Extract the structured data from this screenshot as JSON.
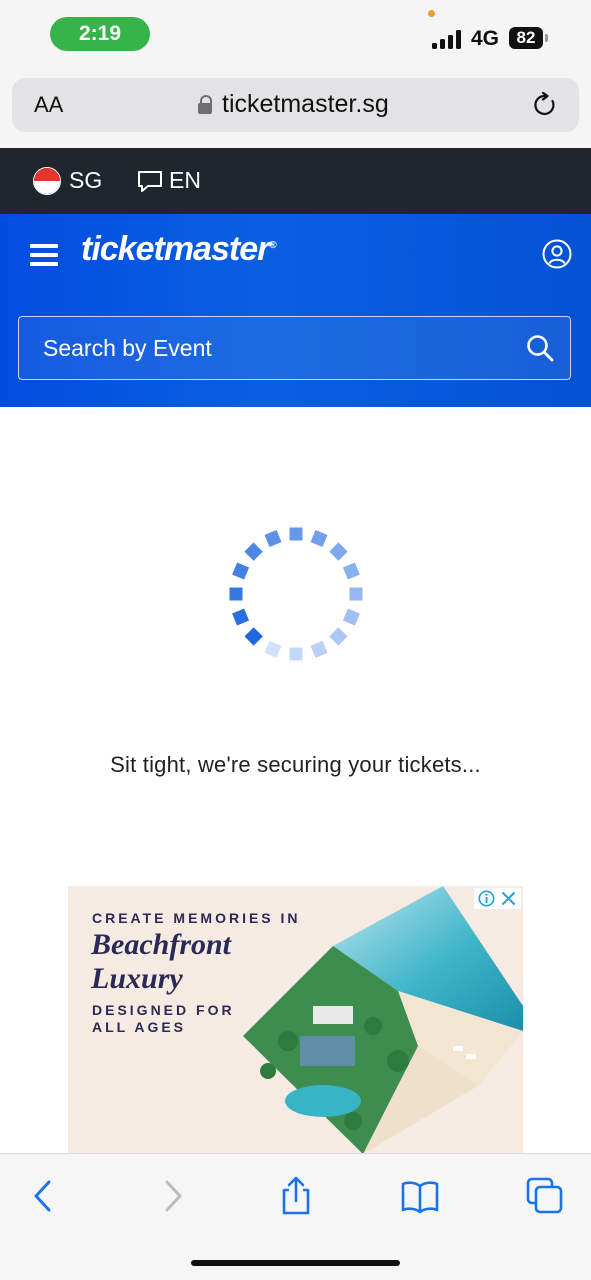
{
  "status_bar": {
    "time": "2:19",
    "network": "4G",
    "battery": "82"
  },
  "browser": {
    "text_size_label": "AA",
    "url": "ticketmaster.sg"
  },
  "locale_bar": {
    "country": "SG",
    "language": "EN"
  },
  "header": {
    "brand": "ticketmaster",
    "trademark": "®",
    "search_placeholder": "Search by Event"
  },
  "loading": {
    "message": "Sit tight, we're securing your tickets..."
  },
  "ad": {
    "line1": "CREATE MEMORIES IN",
    "line2": "Beachfront",
    "line3": "Luxury",
    "line4": "DESIGNED FOR ALL AGES"
  },
  "colors": {
    "brand_blue": "#024ddf",
    "dark_bar": "#1f262d",
    "ios_blue": "#1a73e8",
    "status_green": "#36b44a"
  }
}
